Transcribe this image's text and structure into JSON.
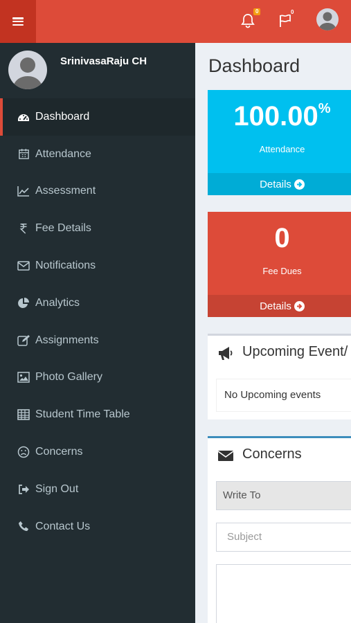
{
  "header": {
    "menu_toggle": "menu-toggle",
    "notifications_count": "0",
    "flags_count": "0"
  },
  "sidebar": {
    "user_name": "SrinivasaRaju CH",
    "items": [
      {
        "label": "Dashboard",
        "icon": "dashboard-icon"
      },
      {
        "label": "Attendance",
        "icon": "calendar-icon"
      },
      {
        "label": "Assessment",
        "icon": "line-chart-icon"
      },
      {
        "label": "Fee Details",
        "icon": "rupee-icon"
      },
      {
        "label": "Notifications",
        "icon": "envelope-icon"
      },
      {
        "label": "Analytics",
        "icon": "pie-chart-icon"
      },
      {
        "label": "Assignments",
        "icon": "edit-icon"
      },
      {
        "label": "Photo Gallery",
        "icon": "picture-icon"
      },
      {
        "label": "Student Time Table",
        "icon": "table-icon"
      },
      {
        "label": "Concerns",
        "icon": "frown-icon"
      },
      {
        "label": "Sign Out",
        "icon": "sign-out-icon"
      },
      {
        "label": "Contact Us",
        "icon": "phone-icon"
      }
    ]
  },
  "main": {
    "title": "Dashboard",
    "attendance": {
      "value": "100.00",
      "unit": "%",
      "label": "Attendance",
      "details": "Details"
    },
    "fee_dues": {
      "value": "0",
      "label": "Fee Dues",
      "details": "Details"
    },
    "events": {
      "title": "Upcoming Event/",
      "empty_text": "No Upcoming events"
    },
    "concerns": {
      "title": "Concerns",
      "write_to": "Write To",
      "subject_placeholder": "Subject"
    }
  },
  "colors": {
    "header": "#dd4b39",
    "sidebar": "#222d32",
    "aqua": "#00c0ef",
    "red": "#dd4b39",
    "active_indicator": "#dd4b39"
  }
}
